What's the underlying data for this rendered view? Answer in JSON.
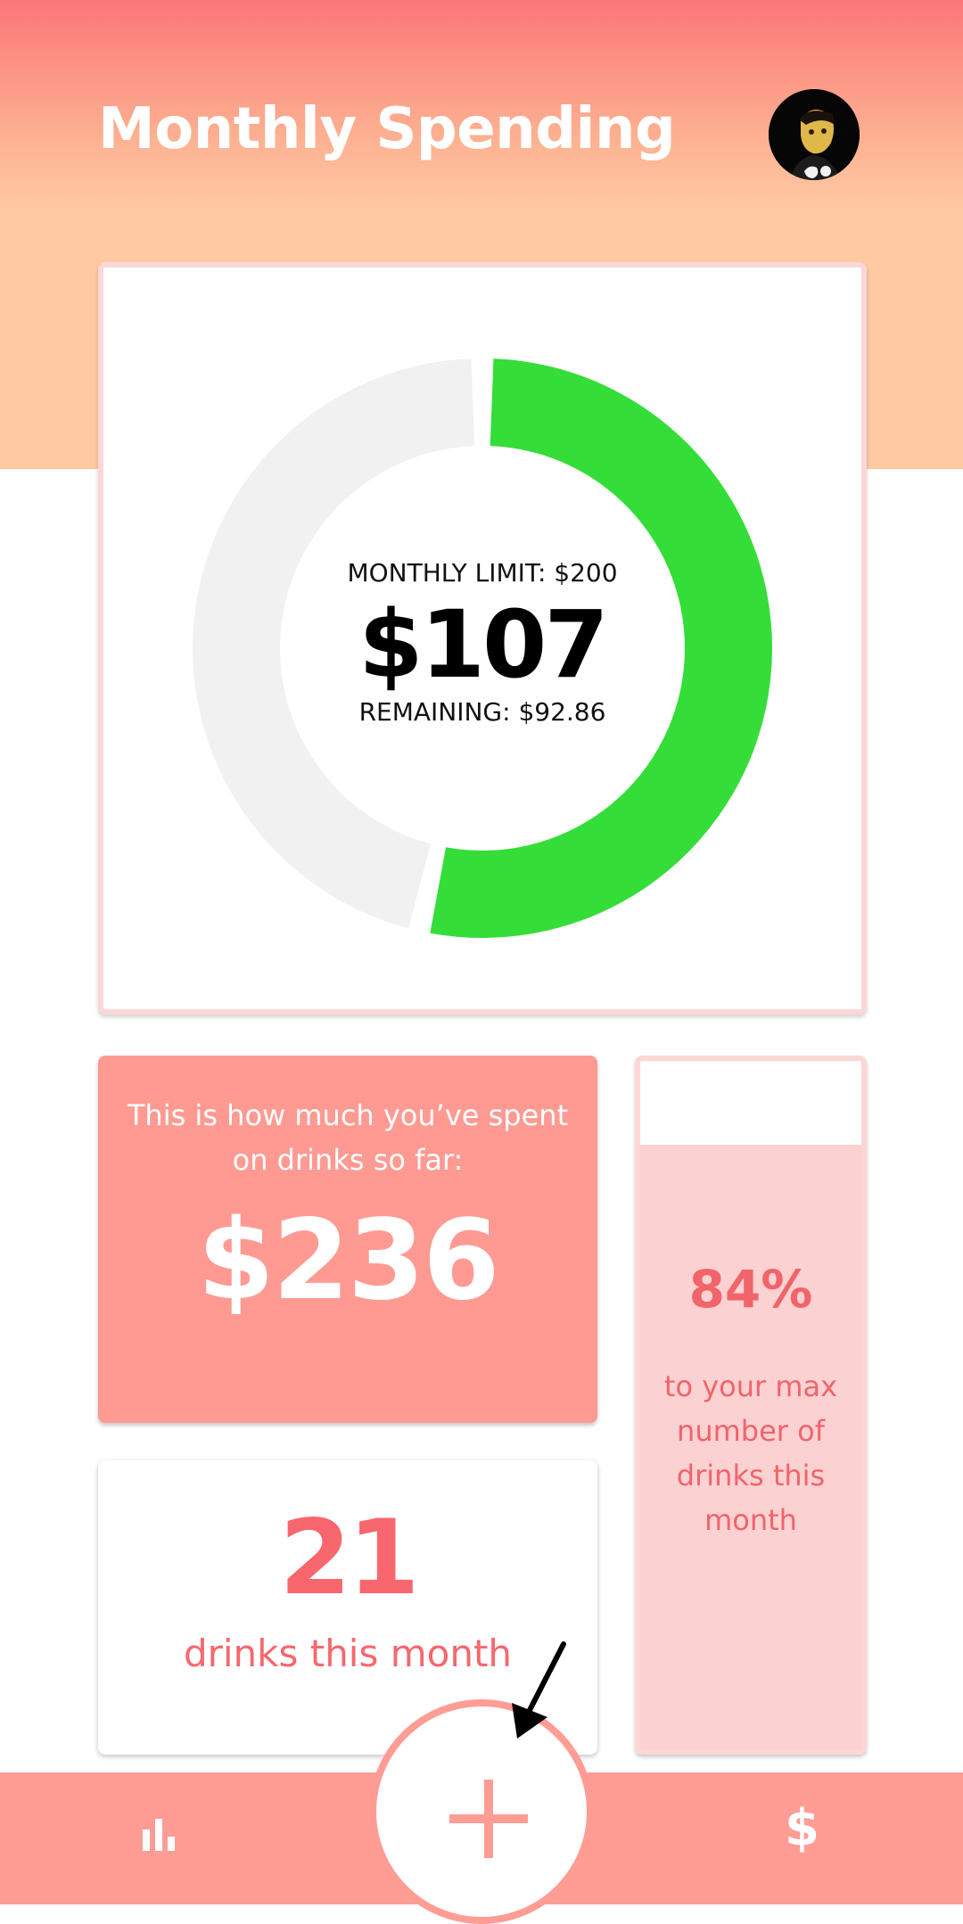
{
  "header": {
    "title": "Monthly Spending",
    "avatar_icon": "user-avatar-photo"
  },
  "budget": {
    "limit_label": "MONTHLY LIMIT: $200",
    "spent_display": "$107",
    "remaining_label": "REMAINING: $92.86",
    "spent_fraction": 0.535,
    "colors": {
      "spent": "#34dd38",
      "remaining": "#f1f1f1"
    }
  },
  "spent_card": {
    "text": "This is how much you’ve spent on drinks so far:",
    "amount": "$236"
  },
  "drinks_card": {
    "count": "21",
    "label": "drinks this month"
  },
  "progress_card": {
    "percent": "84%",
    "text": "to your max number of drinks this month",
    "fill_fraction": 0.84
  },
  "bottom_nav": {
    "left_icon": "bar-chart-icon",
    "center_icon": "plus-icon",
    "right_icon": "dollar-icon",
    "right_glyph": "$"
  },
  "colors": {
    "accent": "#ff9c94",
    "text_accent": "#f7676d"
  }
}
